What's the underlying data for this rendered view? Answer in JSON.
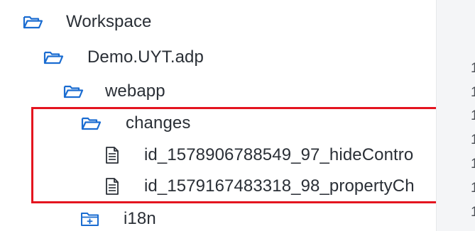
{
  "tree": {
    "items": [
      {
        "label": "Workspace",
        "icon": "folder-open-icon"
      },
      {
        "label": "Demo.UYT.adp",
        "icon": "folder-open-icon"
      },
      {
        "label": "webapp",
        "icon": "folder-open-icon"
      },
      {
        "label": "changes",
        "icon": "folder-open-icon"
      },
      {
        "label": "id_1578906788549_97_hideContro",
        "icon": "document-icon"
      },
      {
        "label": "id_1579167483318_98_propertyCh",
        "icon": "document-icon"
      },
      {
        "label": "i18n",
        "icon": "folder-closed-icon"
      }
    ]
  },
  "gutter": {
    "line_numbers": [
      "1",
      "1",
      "1",
      "1",
      "1",
      "1",
      "1"
    ]
  },
  "colors": {
    "icon_blue": "#1a6cd1",
    "highlight_red": "#e4141f",
    "text": "#2a2f36"
  }
}
